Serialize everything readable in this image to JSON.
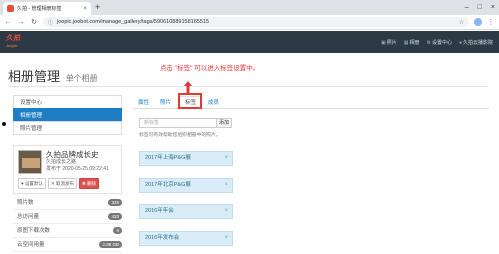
{
  "browser": {
    "tab_title": "久拍 - 管理相册标签",
    "new_tab": "+",
    "tab_close": "×",
    "url": "joopic.joobot.com/manage_gallery/tags/590610889158165515",
    "window_controls": [
      "–",
      "□",
      "×"
    ]
  },
  "site": {
    "logo": "久拍",
    "logo_sub": "Joopic",
    "nav": [
      {
        "icon": "image-icon",
        "label": "照片"
      },
      {
        "icon": "album-icon",
        "label": "相册"
      },
      {
        "icon": "gear-icon",
        "label": "设置中心"
      },
      {
        "icon": "user-icon",
        "label": "久拍云播影院"
      }
    ]
  },
  "page": {
    "title": "相册管理",
    "subtitle": "单个相册"
  },
  "annotation": {
    "text": "点击 \"标签\" 可以进入标签设置中。"
  },
  "sidebar": {
    "items": [
      {
        "label": "设置中心",
        "active": false
      },
      {
        "label": "相册管理",
        "active": true
      },
      {
        "label": "照片管理",
        "active": false
      }
    ]
  },
  "album": {
    "name": "久拍品牌成长史",
    "owner": "久拍成长之路",
    "published": "发布于 2020-05-25 09:22:41",
    "buttons": [
      "设置默认",
      "取消发布",
      "删除"
    ]
  },
  "stats": [
    {
      "label": "照片数",
      "value": "325"
    },
    {
      "label": "总访问量",
      "value": "433"
    },
    {
      "label": "原图下载次数",
      "value": "0"
    },
    {
      "label": "云空间用量",
      "value": "2.88 GB"
    }
  ],
  "tabs": [
    "属性",
    "照片",
    "标签",
    "成员"
  ],
  "tag_editor": {
    "placeholder": "新标签",
    "add_button": "添加",
    "hint": "标签可有效帮助您组织相册中的照片。"
  },
  "tags": [
    "2017年上海P&G展",
    "2017年北京P&G展",
    "2016年年会",
    "2016年发布会"
  ],
  "colors": {
    "header_bg": "#2d3944",
    "sidebar_active": "#1e7ec3",
    "tag_bg": "#d9ecf7",
    "annotation_red": "#e53935"
  }
}
